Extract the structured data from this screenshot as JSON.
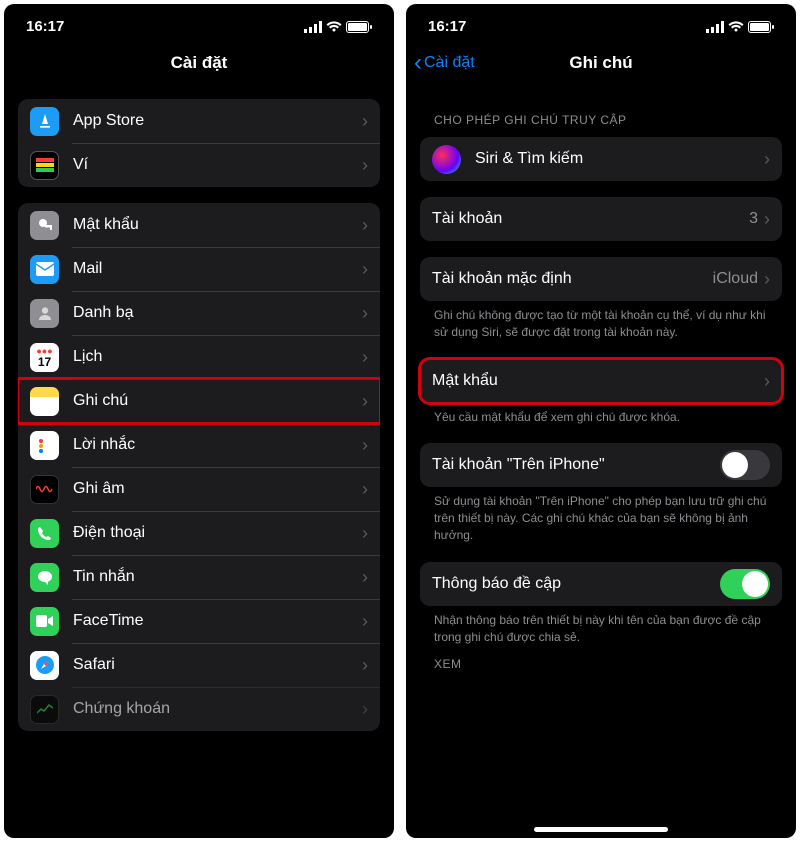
{
  "status": {
    "time": "16:17"
  },
  "left": {
    "title": "Cài đặt",
    "group1": [
      {
        "key": "appstore",
        "label": "App Store"
      },
      {
        "key": "wallet",
        "label": "Ví"
      }
    ],
    "group2": [
      {
        "key": "passwords",
        "label": "Mật khẩu"
      },
      {
        "key": "mail",
        "label": "Mail"
      },
      {
        "key": "contacts",
        "label": "Danh bạ"
      },
      {
        "key": "calendar",
        "label": "Lịch"
      },
      {
        "key": "notes",
        "label": "Ghi chú",
        "highlight": true
      },
      {
        "key": "reminders",
        "label": "Lời nhắc"
      },
      {
        "key": "voicememos",
        "label": "Ghi âm"
      },
      {
        "key": "phone",
        "label": "Điện thoại"
      },
      {
        "key": "messages",
        "label": "Tin nhắn"
      },
      {
        "key": "facetime",
        "label": "FaceTime"
      },
      {
        "key": "safari",
        "label": "Safari"
      },
      {
        "key": "stocks",
        "label": "Chứng khoán"
      }
    ]
  },
  "right": {
    "back": "Cài đặt",
    "title": "Ghi chú",
    "access_header": "CHO PHÉP GHI CHÚ TRUY CẬP",
    "siri_label": "Siri & Tìm kiếm",
    "accounts_label": "Tài khoản",
    "accounts_value": "3",
    "default_account_label": "Tài khoản mặc định",
    "default_account_value": "iCloud",
    "default_account_footer": "Ghi chú không được tạo từ một tài khoản cụ thể, ví dụ như khi sử dụng Siri, sẽ được đặt trong tài khoản này.",
    "password_label": "Mật khẩu",
    "password_footer": "Yêu cầu mật khẩu để xem ghi chú được khóa.",
    "on_iphone_label": "Tài khoản \"Trên iPhone\"",
    "on_iphone_footer": "Sử dụng tài khoản \"Trên iPhone\" cho phép bạn lưu trữ ghi chú trên thiết bị này. Các ghi chú khác của bạn sẽ không bị ảnh hưởng.",
    "mention_label": "Thông báo đề cập",
    "mention_footer": "Nhận thông báo trên thiết bị này khi tên của bạn được đề cập trong ghi chú được chia sẻ.",
    "view_header": "XEM"
  }
}
